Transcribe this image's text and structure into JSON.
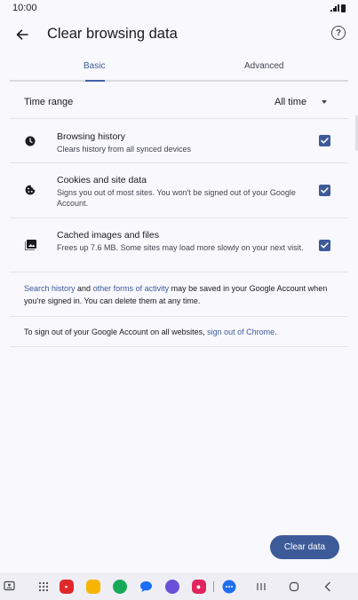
{
  "status_bar": {
    "time": "10:00"
  },
  "app_bar": {
    "title": "Clear browsing data",
    "help_glyph": "?"
  },
  "tabs": [
    {
      "label": "Basic",
      "selected": true
    },
    {
      "label": "Advanced",
      "selected": false
    }
  ],
  "time_range": {
    "label": "Time range",
    "value": "All time"
  },
  "items": [
    {
      "title": "Browsing history",
      "subtitle": "Clears history from all synced devices",
      "checked": true,
      "icon": "clock-icon"
    },
    {
      "title": "Cookies and site data",
      "subtitle": "Signs you out of most sites. You won't be signed out of your Google Account.",
      "checked": true,
      "icon": "cookie-icon"
    },
    {
      "title": "Cached images and files",
      "subtitle": "Frees up 7.6 MB. Some sites may load more slowly on your next visit.",
      "checked": true,
      "icon": "image-icon"
    }
  ],
  "note_activity": {
    "link1": "Search history",
    "text1": " and ",
    "link2": "other forms of activity",
    "text2": " may be saved in your Google Account when you're signed in. You can delete them at any time."
  },
  "note_signout": {
    "text": "To sign out of your Google Account on all websites, ",
    "link": "sign out of Chrome",
    "end": "."
  },
  "clear_button": {
    "label": "Clear data"
  },
  "colors": {
    "accent": "#3d5a99",
    "background": "#f8f8fd"
  }
}
